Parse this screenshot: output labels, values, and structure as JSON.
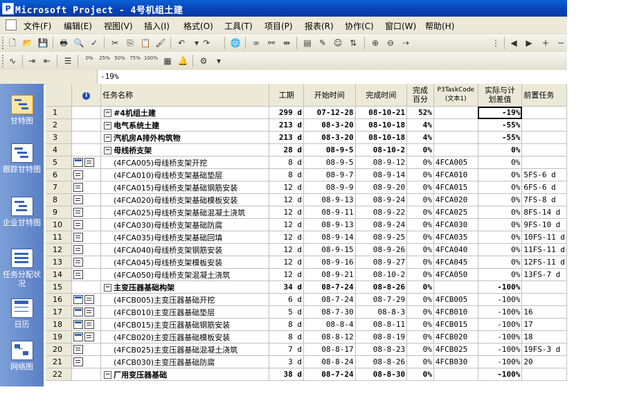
{
  "window": {
    "title": "Microsoft Project - 4号机组土建",
    "app_icon": "project-app-icon"
  },
  "menu": [
    "文件(F)",
    "编辑(E)",
    "视图(V)",
    "插入(I)",
    "格式(O)",
    "工具(T)",
    "项目(P)",
    "报表(R)",
    "协作(C)",
    "窗口(W)",
    "帮助(H)"
  ],
  "toolbar2": {
    "pct": [
      "0%",
      "25%",
      "50%",
      "75%",
      "100%"
    ]
  },
  "entry_bar": {
    "value": "-19%"
  },
  "view_bar": [
    {
      "label": "甘特图",
      "icon": "gantt-chart-icon",
      "selected": true
    },
    {
      "label": "跟踪甘特图",
      "icon": "tracking-gantt-icon",
      "selected": false
    },
    {
      "label": "企业甘特图",
      "icon": "enterprise-gantt-icon",
      "selected": false
    },
    {
      "label": "任务分配状况",
      "icon": "task-usage-icon",
      "selected": false
    },
    {
      "label": "日历",
      "icon": "calendar-icon",
      "selected": false
    },
    {
      "label": "网络图",
      "icon": "network-diagram-icon",
      "selected": false
    }
  ],
  "columns": {
    "info": "i",
    "name": "任务名称",
    "duration": "工期",
    "start": "开始时间",
    "finish": "完成时间",
    "pct_line1": "完成",
    "pct_line2": "百分",
    "p3_line1": "P3TaskCode",
    "p3_line2": "(文本1)",
    "var_line1": "实际与计",
    "var_line2": "划差值",
    "pred": "前置任务"
  },
  "rows": [
    {
      "id": "1",
      "level": 0,
      "summary": true,
      "name": "#4机组土建",
      "duration": "299 d",
      "start": "07-12-28",
      "finish": "08-10-21",
      "pct": "52%",
      "code": "",
      "variance": "-19%",
      "pred": "",
      "icons": []
    },
    {
      "id": "2",
      "level": 1,
      "summary": true,
      "name": "电气系统土建",
      "duration": "213 d",
      "start": "08-3-20",
      "finish": "08-10-18",
      "pct": "4%",
      "code": "",
      "variance": "-55%",
      "pred": "",
      "icons": []
    },
    {
      "id": "3",
      "level": 1,
      "summary": true,
      "name": "汽机房A排外构筑物",
      "duration": "213 d",
      "start": "08-3-20",
      "finish": "08-10-18",
      "pct": "4%",
      "code": "",
      "variance": "-55%",
      "pred": "",
      "icons": []
    },
    {
      "id": "4",
      "level": 1,
      "summary": true,
      "name": "母线桥支架",
      "duration": "28 d",
      "start": "08-9-5",
      "finish": "08-10-2",
      "pct": "0%",
      "code": "",
      "variance": "0%",
      "pred": "",
      "icons": []
    },
    {
      "id": "5",
      "level": 2,
      "summary": false,
      "name": "(4FCA005)母线桥支架开挖",
      "duration": "8 d",
      "start": "08-9-5",
      "finish": "08-9-12",
      "pct": "0%",
      "code": "4FCA005",
      "variance": "0%",
      "pred": "",
      "icons": [
        "cal",
        "note"
      ]
    },
    {
      "id": "6",
      "level": 2,
      "summary": false,
      "name": "(4FCA010)母线桥支架基础垫层",
      "duration": "8 d",
      "start": "08-9-7",
      "finish": "08-9-14",
      "pct": "0%",
      "code": "4FCA010",
      "variance": "0%",
      "pred": "5FS-6 d",
      "icons": [
        "note"
      ]
    },
    {
      "id": "7",
      "level": 2,
      "summary": false,
      "name": "(4FCA015)母线桥支架基础钢筋安装",
      "duration": "12 d",
      "start": "08-9-9",
      "finish": "08-9-20",
      "pct": "0%",
      "code": "4FCA015",
      "variance": "0%",
      "pred": "6FS-6 d",
      "icons": [
        "note"
      ]
    },
    {
      "id": "8",
      "level": 2,
      "summary": false,
      "name": "(4FCA020)母线桥支架基础模板安装",
      "duration": "12 d",
      "start": "08-9-13",
      "finish": "08-9-24",
      "pct": "0%",
      "code": "4FCA020",
      "variance": "0%",
      "pred": "7FS-8 d",
      "icons": [
        "note"
      ]
    },
    {
      "id": "9",
      "level": 2,
      "summary": false,
      "name": "(4FCA025)母线桥支架基础混凝土浇筑",
      "duration": "12 d",
      "start": "08-9-11",
      "finish": "08-9-22",
      "pct": "0%",
      "code": "4FCA025",
      "variance": "0%",
      "pred": "8FS-14 d",
      "icons": [
        "note"
      ]
    },
    {
      "id": "10",
      "level": 2,
      "summary": false,
      "name": "(4FCA030)母线桥支架基础防腐",
      "duration": "12 d",
      "start": "08-9-13",
      "finish": "08-9-24",
      "pct": "0%",
      "code": "4FCA030",
      "variance": "0%",
      "pred": "9FS-10 d",
      "icons": [
        "note"
      ]
    },
    {
      "id": "11",
      "level": 2,
      "summary": false,
      "name": "(4FCA035)母线桥支架基础回填",
      "duration": "12 d",
      "start": "08-9-14",
      "finish": "08-9-25",
      "pct": "0%",
      "code": "4FCA035",
      "variance": "0%",
      "pred": "10FS-11 d",
      "icons": [
        "note"
      ]
    },
    {
      "id": "12",
      "level": 2,
      "summary": false,
      "name": "(4FCA040)母线桥支架钢筋安装",
      "duration": "12 d",
      "start": "08-9-15",
      "finish": "08-9-26",
      "pct": "0%",
      "code": "4FCA040",
      "variance": "0%",
      "pred": "11FS-11 d",
      "icons": [
        "note"
      ]
    },
    {
      "id": "13",
      "level": 2,
      "summary": false,
      "name": "(4FCA045)母线桥支架模板安装",
      "duration": "12 d",
      "start": "08-9-16",
      "finish": "08-9-27",
      "pct": "0%",
      "code": "4FCA045",
      "variance": "0%",
      "pred": "12FS-11 d",
      "icons": [
        "note"
      ]
    },
    {
      "id": "14",
      "level": 2,
      "summary": false,
      "name": "(4FCA050)母线桥支架混凝土浇筑",
      "duration": "12 d",
      "start": "08-9-21",
      "finish": "08-10-2",
      "pct": "0%",
      "code": "4FCA050",
      "variance": "0%",
      "pred": "13FS-7 d",
      "icons": [
        "note"
      ]
    },
    {
      "id": "15",
      "level": 1,
      "summary": true,
      "name": "主变压器基础构架",
      "duration": "34 d",
      "start": "08-7-24",
      "finish": "08-8-26",
      "pct": "0%",
      "code": "",
      "variance": "-100%",
      "pred": "",
      "icons": []
    },
    {
      "id": "16",
      "level": 2,
      "summary": false,
      "name": "(4FCB005)主变压器基础开挖",
      "duration": "6 d",
      "start": "08-7-24",
      "finish": "08-7-29",
      "pct": "0%",
      "code": "4FCB005",
      "variance": "-100%",
      "pred": "",
      "icons": [
        "cal",
        "note"
      ]
    },
    {
      "id": "17",
      "level": 2,
      "summary": false,
      "name": "(4FCB010)主变压器基础垫层",
      "duration": "5 d",
      "start": "08-7-30",
      "finish": "08-8-3",
      "pct": "0%",
      "code": "4FCB010",
      "variance": "-100%",
      "pred": "16",
      "icons": [
        "cal",
        "note"
      ]
    },
    {
      "id": "18",
      "level": 2,
      "summary": false,
      "name": "(4FCB015)主变压器基础钢筋安装",
      "duration": "8 d",
      "start": "08-8-4",
      "finish": "08-8-11",
      "pct": "0%",
      "code": "4FCB015",
      "variance": "-100%",
      "pred": "17",
      "icons": [
        "cal",
        "note"
      ]
    },
    {
      "id": "19",
      "level": 2,
      "summary": false,
      "name": "(4FCB020)主变压器基础模板安装",
      "duration": "8 d",
      "start": "08-8-12",
      "finish": "08-8-19",
      "pct": "0%",
      "code": "4FCB020",
      "variance": "-100%",
      "pred": "18",
      "icons": [
        "cal",
        "note"
      ]
    },
    {
      "id": "20",
      "level": 2,
      "summary": false,
      "name": "(4FCB025)主变压器基础混凝土浇筑",
      "duration": "7 d",
      "start": "08-8-17",
      "finish": "08-8-23",
      "pct": "0%",
      "code": "4FCB025",
      "variance": "-100%",
      "pred": "19FS-3 d",
      "icons": [
        "note"
      ]
    },
    {
      "id": "21",
      "level": 2,
      "summary": false,
      "name": "(4FCB030)主变压器基础防腐",
      "duration": "3 d",
      "start": "08-8-24",
      "finish": "08-8-26",
      "pct": "0%",
      "code": "4FCB030",
      "variance": "-100%",
      "pred": "20",
      "icons": [
        "note"
      ]
    },
    {
      "id": "22",
      "level": 1,
      "summary": true,
      "name": "厂用变压器基础",
      "duration": "38 d",
      "start": "08-7-24",
      "finish": "08-8-30",
      "pct": "0%",
      "code": "",
      "variance": "-100%",
      "pred": "",
      "icons": []
    }
  ]
}
